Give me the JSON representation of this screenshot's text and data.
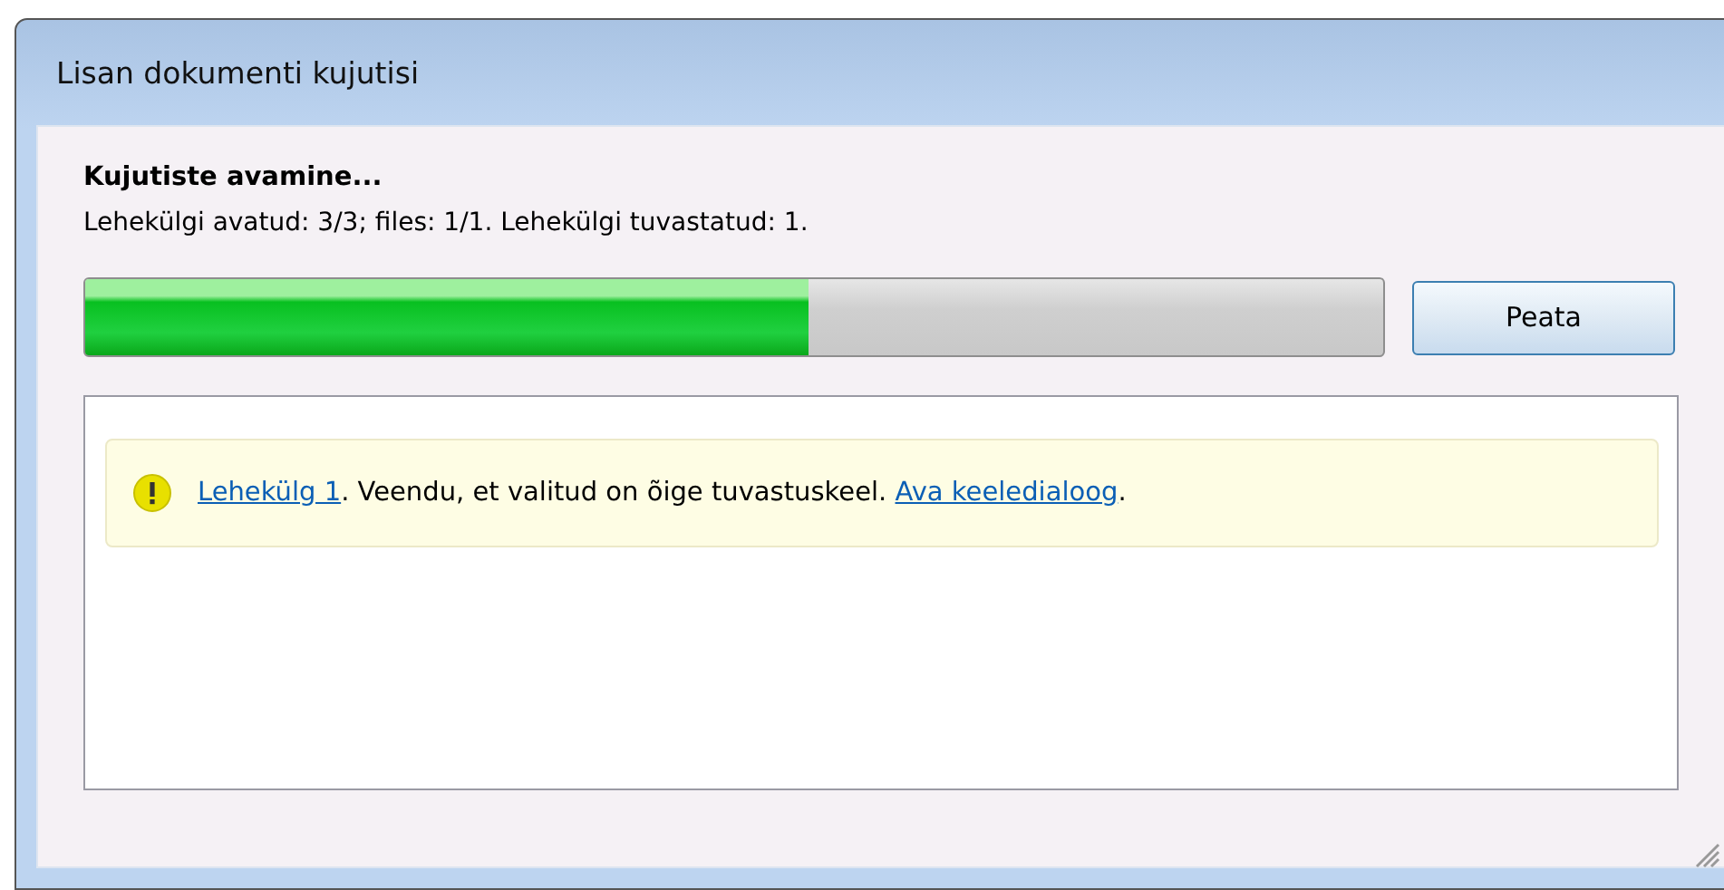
{
  "window": {
    "title": "Lisan dokumenti kujutisi"
  },
  "status": {
    "heading": "Kujutiste avamine...",
    "detail": "Lehekülgi avatud: 3/3; files: 1/1. Lehekülgi tuvastatud: 1."
  },
  "progress": {
    "level": 0.557
  },
  "buttons": [
    "Peata"
  ],
  "messages": [
    {
      "kind": "warning",
      "parts": [
        {
          "kind": "link",
          "text": "Lehekülg 1"
        },
        {
          "kind": "text",
          "text": ". Veendu, et valitud on õige tuvastuskeel. "
        },
        {
          "kind": "link",
          "text": "Ava keeledialoog"
        },
        {
          "kind": "text",
          "text": "."
        }
      ]
    }
  ]
}
